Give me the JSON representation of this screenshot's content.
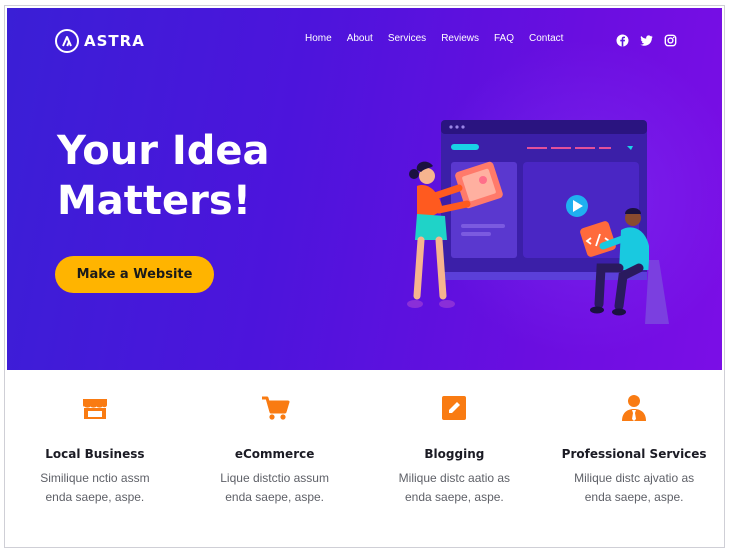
{
  "brand": {
    "name": "ASTRA"
  },
  "nav": {
    "items": [
      "Home",
      "About",
      "Services",
      "Reviews",
      "FAQ",
      "Contact"
    ]
  },
  "socials": [
    "facebook-icon",
    "twitter-icon",
    "instagram-icon"
  ],
  "hero": {
    "headline_line1": "Your Idea",
    "headline_line2": "Matters!",
    "cta_label": "Make a Website"
  },
  "features": [
    {
      "icon": "store-icon",
      "title": "Local Business",
      "desc_line1": "Similique nctio assm",
      "desc_line2": "enda saepe, aspe."
    },
    {
      "icon": "cart-icon",
      "title": "eCommerce",
      "desc_line1": "Lique distctio assum",
      "desc_line2": "enda saepe, aspe."
    },
    {
      "icon": "pencil-icon",
      "title": "Blogging",
      "desc_line1": "Milique distc aatio as",
      "desc_line2": "enda saepe, aspe."
    },
    {
      "icon": "person-icon",
      "title": "Professional Services",
      "desc_line1": "Milique distc ajvatio as",
      "desc_line2": "enda saepe, aspe."
    }
  ],
  "colors": {
    "hero_start": "#3a1fd6",
    "hero_end": "#7b0ee6",
    "cta": "#ffb400",
    "feature_icon": "#f97b12"
  }
}
